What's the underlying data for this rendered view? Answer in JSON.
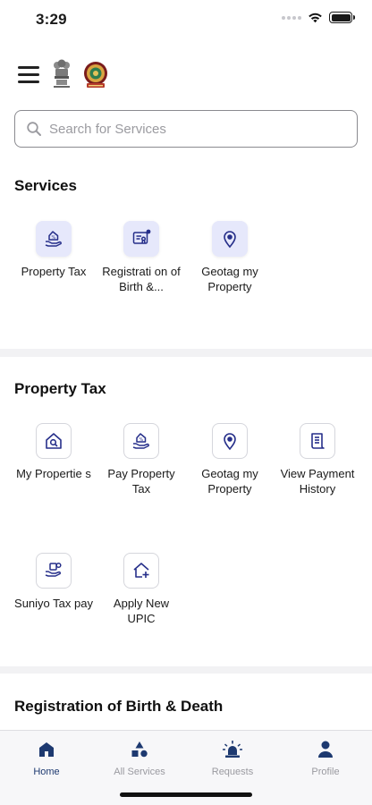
{
  "status": {
    "time": "3:29"
  },
  "search": {
    "placeholder": "Search for Services"
  },
  "services": {
    "title": "Services",
    "items": [
      {
        "label": "Property Tax"
      },
      {
        "label": "Registrati on of Birth &..."
      },
      {
        "label": "Geotag my Property"
      }
    ]
  },
  "property_tax": {
    "title": "Property Tax",
    "items": [
      {
        "label": "My Propertie s"
      },
      {
        "label": "Pay Property Tax"
      },
      {
        "label": "Geotag my Property"
      },
      {
        "label": "View Payment History"
      },
      {
        "label": "Suniyo Tax pay"
      },
      {
        "label": "Apply New UPIC"
      }
    ]
  },
  "registration": {
    "title": "Registration of Birth & Death"
  },
  "tabbar": {
    "items": [
      {
        "label": "Home",
        "icon": "home-icon",
        "active": true
      },
      {
        "label": "All Services",
        "icon": "shapes-icon"
      },
      {
        "label": "Requests",
        "icon": "siren-icon"
      },
      {
        "label": "Profile",
        "icon": "person-icon"
      }
    ]
  },
  "colors": {
    "accent": "#1d3970",
    "icon_bg": "#e6e8fb",
    "icon_stroke": "#262f8a"
  }
}
